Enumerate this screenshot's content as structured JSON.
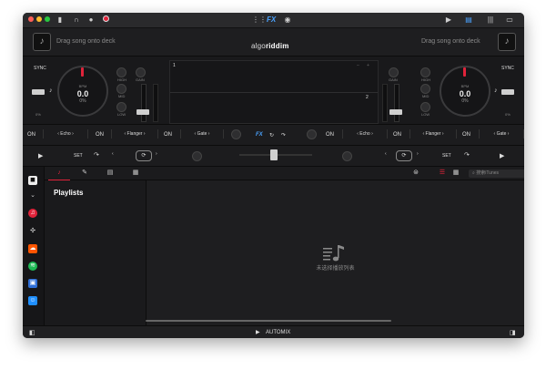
{
  "deck": {
    "left_placeholder": "Drag song onto deck",
    "right_placeholder": "Drag song onto deck"
  },
  "logo": {
    "part1": "algo",
    "part2": "riddim"
  },
  "toolbar": {
    "fx_label": "FX"
  },
  "deck_left": {
    "sync": "SYNC",
    "bpm_label": "BPM",
    "bpm_value": "0.0",
    "percent": "0%",
    "pct_small": "0%",
    "knob_labels": [
      "HIGH",
      "MID",
      "LOW"
    ],
    "gain": "GAIN"
  },
  "deck_right": {
    "sync": "SYNC",
    "bpm_label": "BPM",
    "bpm_value": "0.0",
    "percent": "0%",
    "pct_small": "0%",
    "knob_labels": [
      "HIGH",
      "MID",
      "LOW"
    ],
    "gain": "GAIN"
  },
  "waveform": {
    "deck1": "1",
    "deck2": "2"
  },
  "fx": {
    "on": "ON",
    "left": [
      "Echo",
      "Flanger",
      "Gate"
    ],
    "right": [
      "Echo",
      "Flanger",
      "Gate"
    ],
    "center": "FX"
  },
  "loop": {
    "set": "SET"
  },
  "library": {
    "playlists_title": "Playlists",
    "empty_text": "未选择播放列表",
    "search_placeholder": "搜索iTunes"
  },
  "bottom": {
    "automix": "AUTOMIX"
  },
  "colors": {
    "accent": "#e0233a",
    "bg": "#1c1c1e"
  }
}
